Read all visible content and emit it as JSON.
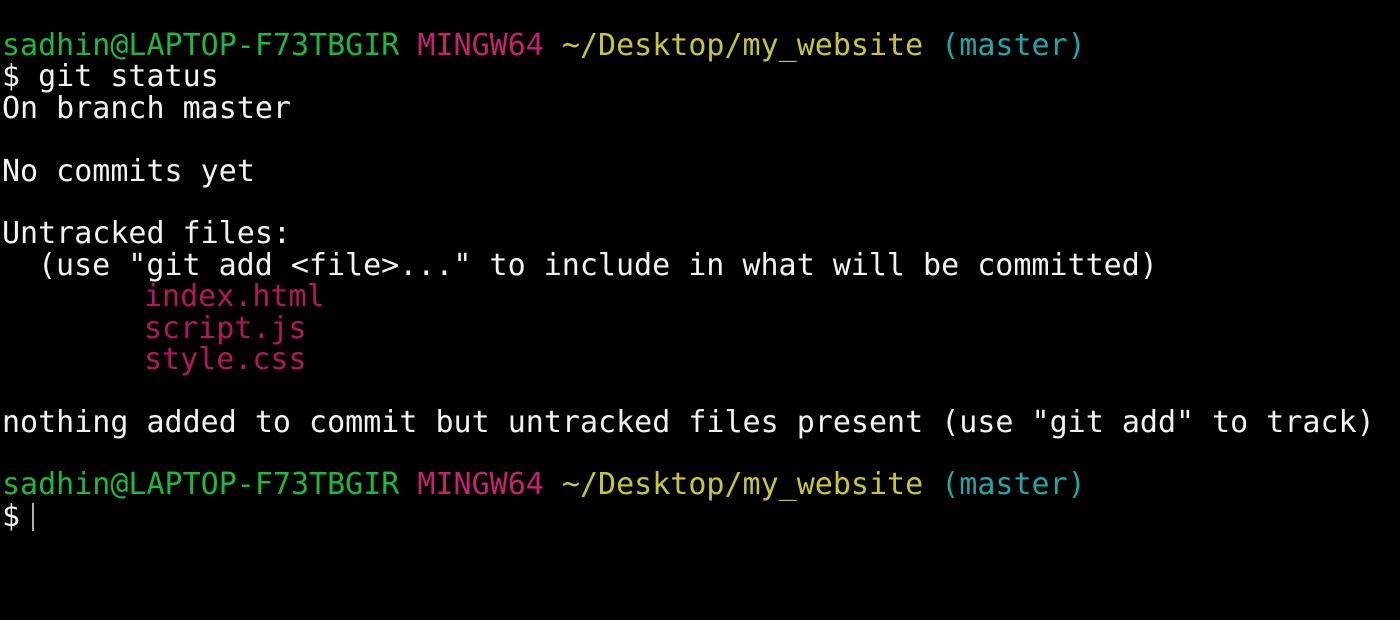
{
  "colors": {
    "background": "#000000",
    "text": "#f2f2f2",
    "user_host": "#20b83a",
    "shell_name": "#c2246e",
    "path": "#c6c63a",
    "branch": "#25a6a6",
    "untracked_file": "#b3185c"
  },
  "prompt": {
    "user_host": "sadhin@LAPTOP-F73TBGIR",
    "shell": "MINGW64",
    "path": "~/Desktop/my_website",
    "branch": "(master)",
    "symbol": "$"
  },
  "command": "git status",
  "output": {
    "branch_line": "On branch master",
    "commits_line": "No commits yet",
    "untracked_header": "Untracked files:",
    "hint": "(use \"git add <file>...\" to include in what will be committed)",
    "files": [
      "index.html",
      "script.js",
      "style.css"
    ],
    "summary": "nothing added to commit but untracked files present (use \"git add\" to track)"
  }
}
